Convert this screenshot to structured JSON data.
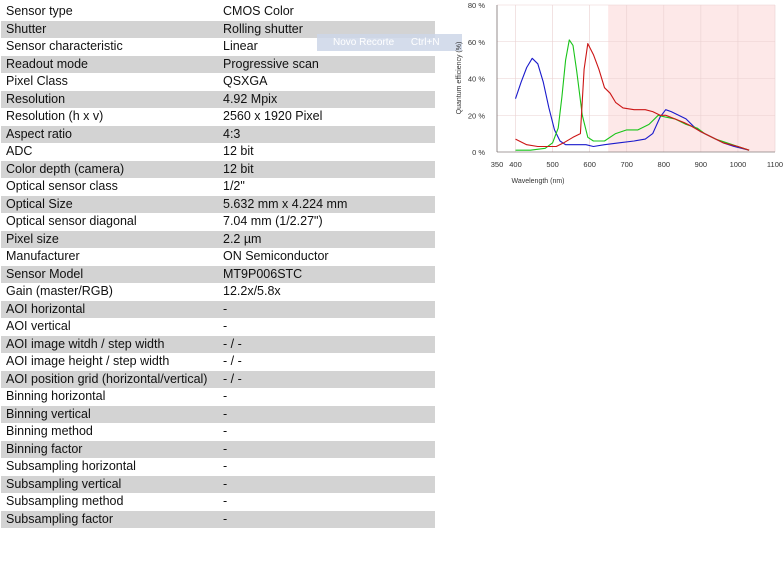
{
  "specs": [
    {
      "label": "Sensor type",
      "value": "CMOS Color"
    },
    {
      "label": "Shutter",
      "value": "Rolling shutter"
    },
    {
      "label": "Sensor characteristic",
      "value": "Linear"
    },
    {
      "label": "Readout mode",
      "value": "Progressive scan"
    },
    {
      "label": "Pixel Class",
      "value": "QSXGA"
    },
    {
      "label": "Resolution",
      "value": "4.92 Mpix"
    },
    {
      "label": "Resolution (h x v)",
      "value": "2560 x 1920 Pixel"
    },
    {
      "label": "Aspect ratio",
      "value": "4:3"
    },
    {
      "label": "ADC",
      "value": "12 bit"
    },
    {
      "label": "Color depth (camera)",
      "value": "12 bit"
    },
    {
      "label": "Optical sensor class",
      "value": "1/2\""
    },
    {
      "label": "Optical Size",
      "value": "5.632 mm x 4.224 mm"
    },
    {
      "label": "Optical sensor diagonal",
      "value": "7.04 mm (1/2.27\")"
    },
    {
      "label": "Pixel size",
      "value": "2.2 µm"
    },
    {
      "label": "Manufacturer",
      "value": "ON Semiconductor"
    },
    {
      "label": "Sensor Model",
      "value": "MT9P006STC"
    },
    {
      "label": "Gain (master/RGB)",
      "value": "12.2x/5.8x"
    },
    {
      "label": "AOI horizontal",
      "value": "-"
    },
    {
      "label": "AOI vertical",
      "value": "-"
    },
    {
      "label": "AOI image witdh / step width",
      "value": "- / -"
    },
    {
      "label": "AOI image height / step width",
      "value": "- / -"
    },
    {
      "label": "AOI position grid (horizontal/vertical)",
      "value": "- / -"
    },
    {
      "label": "Binning horizontal",
      "value": "-"
    },
    {
      "label": "Binning vertical",
      "value": "-"
    },
    {
      "label": "Binning method",
      "value": "-"
    },
    {
      "label": "Binning factor",
      "value": "-"
    },
    {
      "label": "Subsampling horizontal",
      "value": "-"
    },
    {
      "label": "Subsampling vertical",
      "value": "-"
    },
    {
      "label": "Subsampling method",
      "value": "-"
    },
    {
      "label": "Subsampling factor",
      "value": "-"
    }
  ],
  "overlay": {
    "label": "Novo Recorte",
    "shortcut": "Ctrl+N"
  },
  "chart_data": {
    "type": "line",
    "title": "",
    "xlabel": "Wavelength (nm)",
    "ylabel": "Quantum efficiency (%)",
    "xlim": [
      350,
      1100
    ],
    "ylim": [
      0,
      80
    ],
    "x_ticks": [
      "350",
      "400",
      "500",
      "600",
      "700",
      "800",
      "900",
      "1000",
      "1100"
    ],
    "y_ticks": [
      "0 %",
      "20 %",
      "40 %",
      "60 %",
      "80 %"
    ],
    "shaded_region": {
      "from": 650,
      "to": 1100,
      "color": "#fde8e8"
    },
    "series": [
      {
        "color": "#1a1acc",
        "points": [
          [
            400,
            29
          ],
          [
            415,
            38
          ],
          [
            430,
            46
          ],
          [
            445,
            51
          ],
          [
            460,
            48
          ],
          [
            475,
            38
          ],
          [
            490,
            24
          ],
          [
            505,
            12
          ],
          [
            520,
            6
          ],
          [
            535,
            4
          ],
          [
            550,
            4
          ],
          [
            570,
            4
          ],
          [
            590,
            4
          ],
          [
            610,
            3
          ],
          [
            640,
            4
          ],
          [
            680,
            5
          ],
          [
            720,
            6
          ],
          [
            750,
            7
          ],
          [
            770,
            10
          ],
          [
            790,
            19
          ],
          [
            805,
            23
          ],
          [
            820,
            22
          ],
          [
            840,
            20
          ],
          [
            860,
            18
          ],
          [
            880,
            14
          ],
          [
            900,
            11
          ],
          [
            930,
            8
          ],
          [
            960,
            5
          ],
          [
            990,
            3
          ],
          [
            1030,
            1
          ]
        ]
      },
      {
        "color": "#19c419",
        "points": [
          [
            400,
            1
          ],
          [
            440,
            1
          ],
          [
            480,
            2
          ],
          [
            500,
            5
          ],
          [
            515,
            13
          ],
          [
            525,
            30
          ],
          [
            535,
            50
          ],
          [
            545,
            61
          ],
          [
            555,
            58
          ],
          [
            565,
            44
          ],
          [
            580,
            20
          ],
          [
            595,
            8
          ],
          [
            610,
            6
          ],
          [
            640,
            6
          ],
          [
            670,
            10
          ],
          [
            700,
            12
          ],
          [
            730,
            12
          ],
          [
            760,
            15
          ],
          [
            785,
            20
          ],
          [
            805,
            19
          ],
          [
            830,
            18
          ],
          [
            860,
            15
          ],
          [
            890,
            13
          ],
          [
            910,
            10
          ],
          [
            940,
            7
          ],
          [
            970,
            5
          ],
          [
            1000,
            3
          ],
          [
            1030,
            1
          ]
        ]
      },
      {
        "color": "#cc1515",
        "points": [
          [
            400,
            7
          ],
          [
            430,
            4
          ],
          [
            460,
            3
          ],
          [
            490,
            3
          ],
          [
            510,
            3
          ],
          [
            530,
            5
          ],
          [
            555,
            8
          ],
          [
            575,
            10
          ],
          [
            585,
            45
          ],
          [
            595,
            59
          ],
          [
            610,
            53
          ],
          [
            625,
            45
          ],
          [
            640,
            35
          ],
          [
            655,
            32
          ],
          [
            670,
            27
          ],
          [
            690,
            24
          ],
          [
            720,
            23
          ],
          [
            750,
            23
          ],
          [
            770,
            22
          ],
          [
            790,
            20
          ],
          [
            805,
            20
          ],
          [
            830,
            18
          ],
          [
            855,
            16
          ],
          [
            875,
            14
          ],
          [
            900,
            11
          ],
          [
            930,
            8
          ],
          [
            960,
            5
          ],
          [
            1000,
            3
          ],
          [
            1030,
            1
          ]
        ]
      }
    ]
  }
}
